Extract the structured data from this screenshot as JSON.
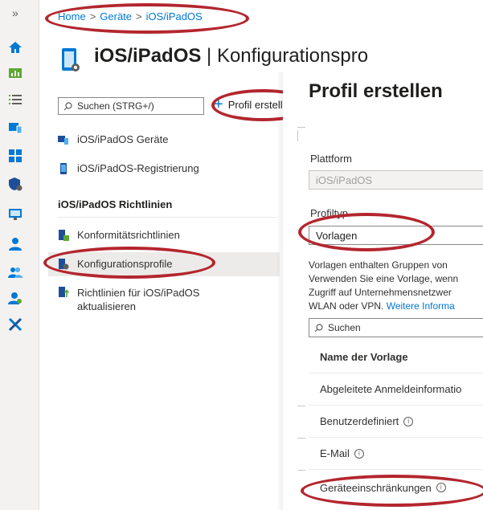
{
  "rail": {
    "collapse_glyph": "»",
    "icons": [
      "home-icon",
      "dashboard-icon",
      "list-icon",
      "devices-icon",
      "apps-icon",
      "security-icon",
      "monitor-icon",
      "user-icon",
      "groups-icon",
      "tenant-admin-icon",
      "tools-icon"
    ]
  },
  "breadcrumb": {
    "home": "Home",
    "geraete": "Geräte",
    "ios": "iOS/iPadOS",
    "separator": ">"
  },
  "header": {
    "title_bold": "iOS/iPadOS",
    "title_rest": " | Konfigurationspro"
  },
  "left": {
    "search_placeholder": "Suchen (STRG+/)",
    "create_button": "Profil erstell",
    "items": [
      {
        "label": "iOS/iPadOS Geräte"
      },
      {
        "label": "iOS/iPadOS-Registrierung"
      }
    ],
    "section_heading": "iOS/iPadOS Richtlinien",
    "policies": [
      {
        "label": "Konformitätsrichtlinien"
      },
      {
        "label": "Konfigurationsprofile"
      },
      {
        "label_line1": "Richtlinien für iOS/iPadOS",
        "label_line2": "aktualisieren"
      }
    ]
  },
  "panel": {
    "title": "Profil erstellen",
    "platform_label": "Plattform",
    "platform_value": "iOS/iPadOS",
    "profiltyp_label": "Profiltyp",
    "profiltyp_value": "Vorlagen",
    "description": [
      "Vorlagen enthalten Gruppen von",
      "Verwenden Sie eine Vorlage, wenn",
      "Zugriff auf Unternehmensnetzwer",
      "WLAN oder VPN. "
    ],
    "more_info_link": "Weitere Informa",
    "search_placeholder": "Suchen",
    "table_header": "Name der Vorlage",
    "templates": [
      "Abgeleitete Anmeldeinformatio",
      "Benutzerdefiniert",
      "E-Mail",
      "Geräteeinschränkungen"
    ]
  },
  "colors": {
    "accent": "#0078d4",
    "highlight_ellipse": "#b3262e"
  }
}
